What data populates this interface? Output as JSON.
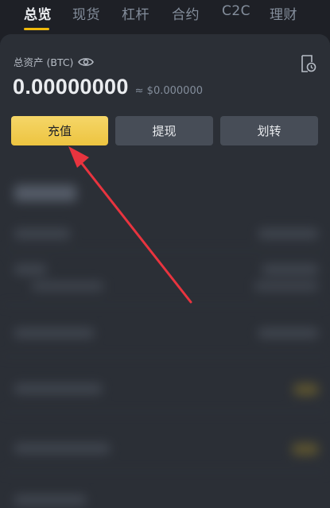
{
  "tabs": [
    {
      "label": "总览",
      "active": true
    },
    {
      "label": "现货",
      "active": false
    },
    {
      "label": "杠杆",
      "active": false
    },
    {
      "label": "合约",
      "active": false
    },
    {
      "label": "C2C",
      "active": false
    },
    {
      "label": "理财",
      "active": false
    }
  ],
  "asset": {
    "label": "总资产 (BTC)",
    "balance": "0.00000000",
    "fiat": "≈ $0.000000"
  },
  "actions": {
    "deposit": "充值",
    "withdraw": "提现",
    "transfer": "划转"
  },
  "colors": {
    "accent": "#f0b90b",
    "deposit_button": "#f0cf53",
    "background": "#1e2026",
    "card": "#2b2f36",
    "annotation_arrow": "#e8343f"
  },
  "icons": {
    "visibility": "eye-icon",
    "history": "history-icon"
  }
}
